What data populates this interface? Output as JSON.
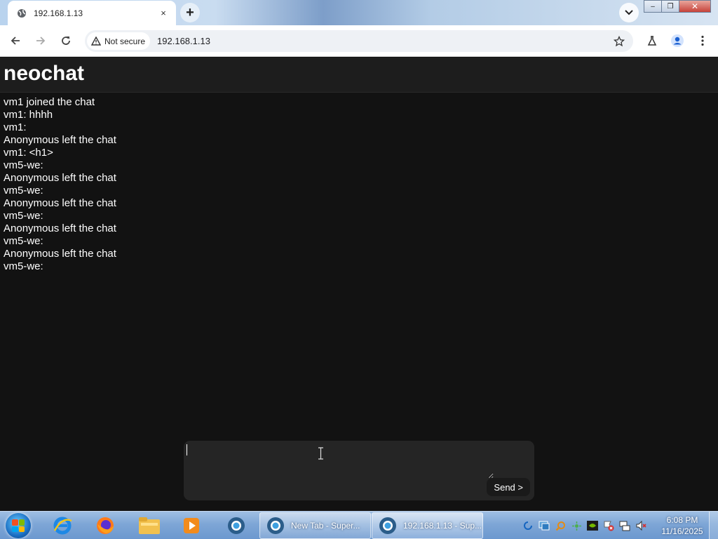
{
  "browser": {
    "tab": {
      "title": "192.168.1.13",
      "close_icon": "×"
    },
    "new_tab_icon": "+",
    "window_controls": {
      "minimize": "–",
      "maximize": "❐",
      "close": "✕"
    },
    "address": {
      "security_label": "Not secure",
      "url": "192.168.1.13"
    }
  },
  "page": {
    "brand": "neochat",
    "messages": [
      "vm1 joined the chat",
      "vm1: hhhh",
      "vm1: ",
      "Anonymous left the chat",
      "vm1: <h1>",
      "vm5-we: ",
      "Anonymous left the chat",
      "vm5-we: ",
      "Anonymous left the chat",
      "vm5-we: ",
      "Anonymous left the chat",
      "vm5-we: ",
      "Anonymous left the chat",
      "vm5-we: "
    ],
    "composer": {
      "value": "",
      "send_label": "Send >"
    }
  },
  "taskbar": {
    "tasks": [
      {
        "label": "New Tab - Super..."
      },
      {
        "label": "192.168.1.13 - Sup..."
      }
    ],
    "clock": {
      "time": "6:08 PM",
      "date": "11/16/2025"
    }
  },
  "colors": {
    "page_bg": "#121212",
    "header_bg": "#1d1d1d",
    "composer_bg": "#252525",
    "text": "#ffffff"
  }
}
